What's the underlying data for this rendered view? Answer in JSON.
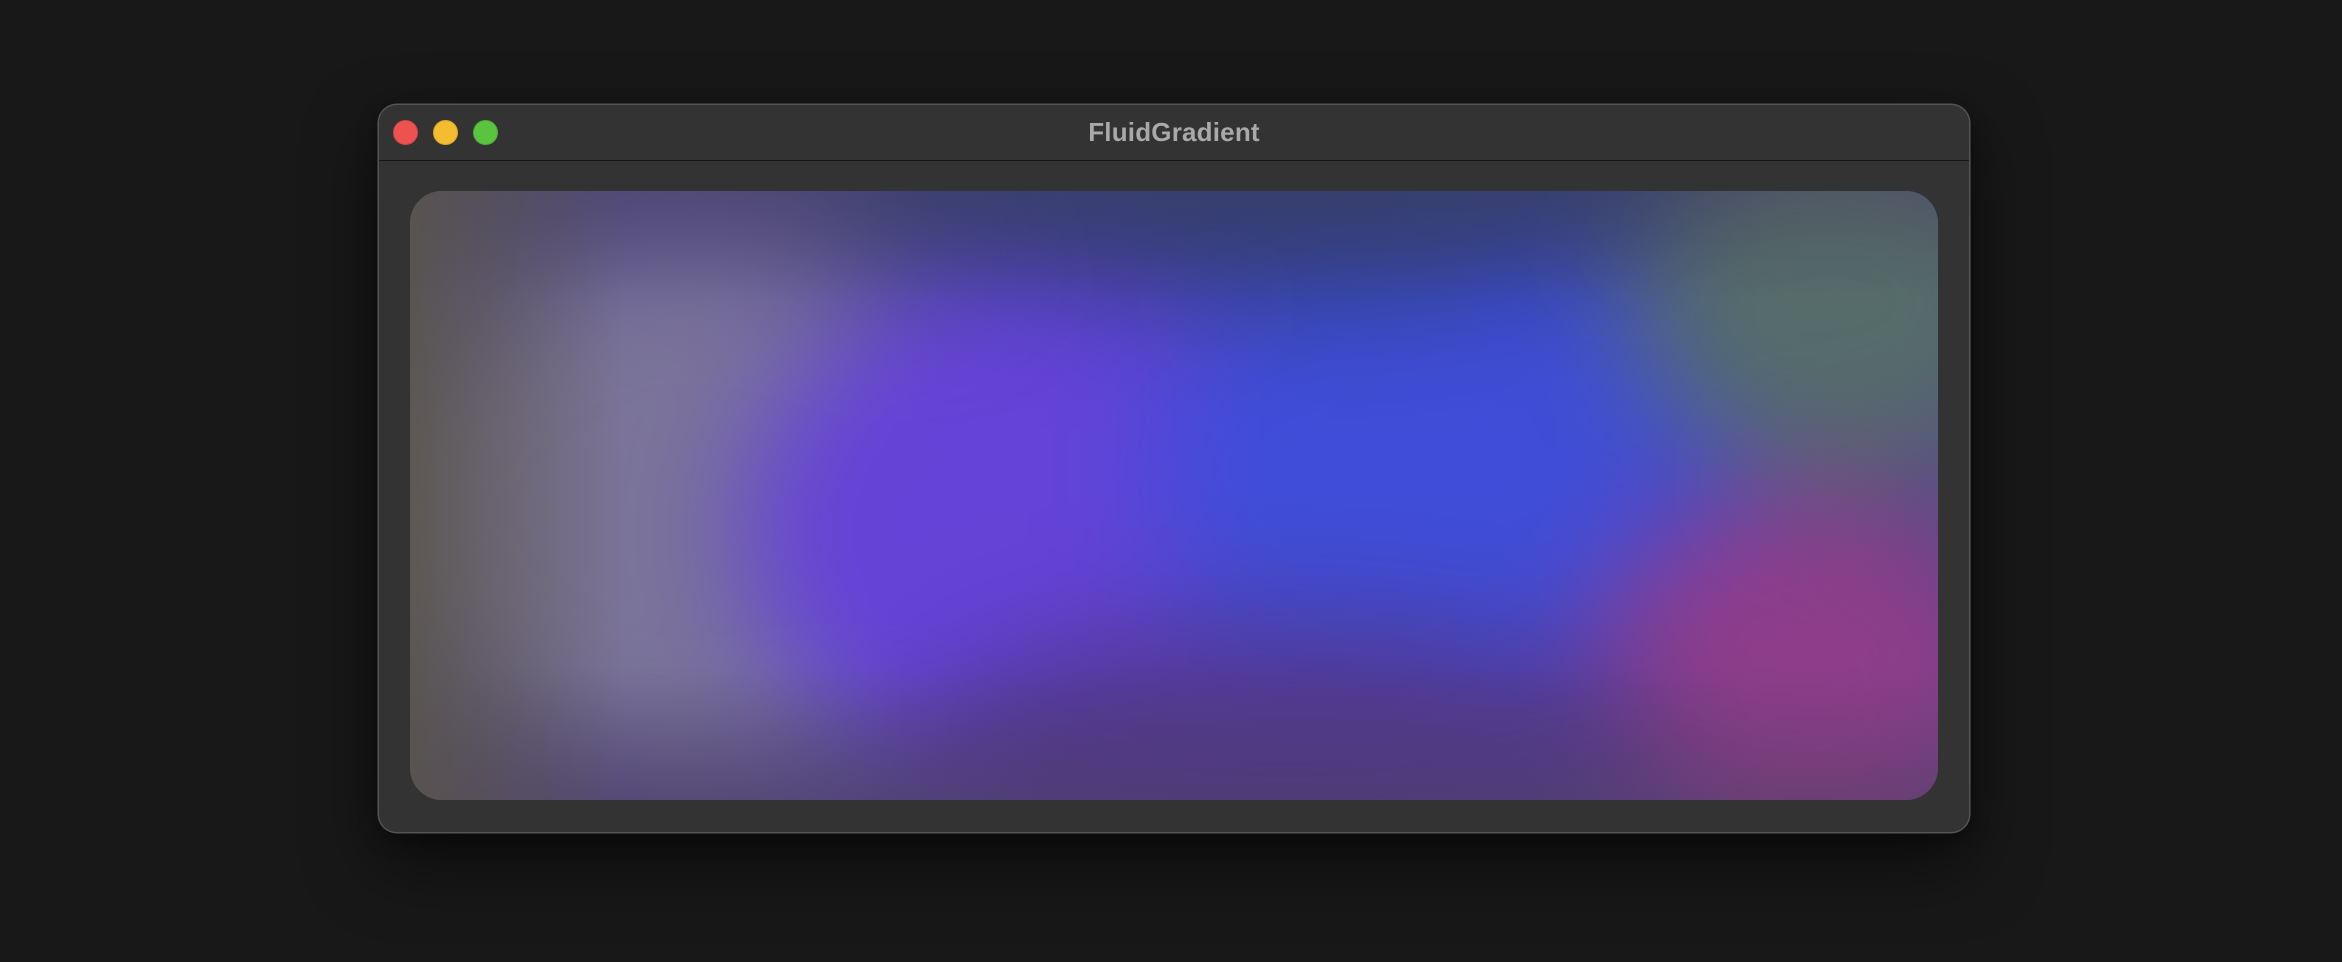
{
  "window": {
    "title": "FluidGradient",
    "traffic_lights": {
      "close_color": "#ec5350",
      "minimize_color": "#f4bd30",
      "zoom_color": "#5ac43f"
    }
  },
  "gradient": {
    "colors": [
      "#7a7396",
      "#6447d6",
      "#3f4bd6",
      "#8a3c88",
      "#556b6a",
      "#2e3f7e",
      "#5a5a4e"
    ]
  }
}
